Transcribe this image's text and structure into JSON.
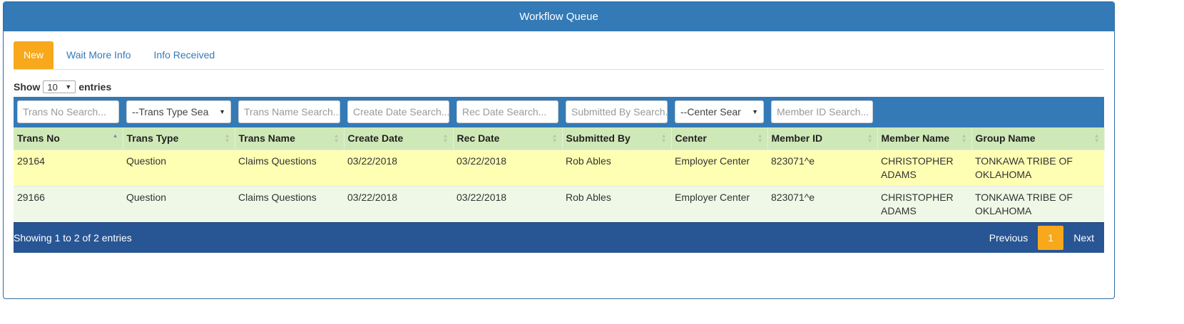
{
  "panel": {
    "title": "Workflow Queue"
  },
  "tabs": [
    {
      "label": "New",
      "active": true
    },
    {
      "label": "Wait More Info",
      "active": false
    },
    {
      "label": "Info Received",
      "active": false
    }
  ],
  "length": {
    "prefix": "Show",
    "value": "10",
    "suffix": "entries"
  },
  "filters": {
    "trans_no": "Trans No Search...",
    "trans_type": "--Trans Type Sea",
    "trans_name": "Trans Name Search...",
    "create_date": "Create Date Search...",
    "rec_date": "Rec Date Search...",
    "submitted_by": "Submitted By Search...",
    "center": "--Center Sear",
    "member_id": "Member ID Search..."
  },
  "columns": [
    "Trans No",
    "Trans Type",
    "Trans Name",
    "Create Date",
    "Rec Date",
    "Submitted By",
    "Center",
    "Member ID",
    "Member Name",
    "Group Name"
  ],
  "rows": [
    [
      "29164",
      "Question",
      "Claims Questions",
      "03/22/2018",
      "03/22/2018",
      "Rob Ables",
      "Employer Center",
      "823071^e",
      "CHRISTOPHER ADAMS",
      "TONKAWA TRIBE OF OKLAHOMA"
    ],
    [
      "29166",
      "Question",
      "Claims Questions",
      "03/22/2018",
      "03/22/2018",
      "Rob Ables",
      "Employer Center",
      "823071^e",
      "CHRISTOPHER ADAMS",
      "TONKAWA TRIBE OF OKLAHOMA"
    ]
  ],
  "footer": {
    "info": "Showing 1 to 2 of 2 entries",
    "previous": "Previous",
    "page": "1",
    "next": "Next"
  },
  "colors": {
    "header_blue": "#337ab7",
    "footer_blue": "#285594",
    "accent_orange": "#f7a81b",
    "head_green": "#cfe8b7",
    "row_yellow": "#ffffb3",
    "row_green": "#eff8e6"
  }
}
